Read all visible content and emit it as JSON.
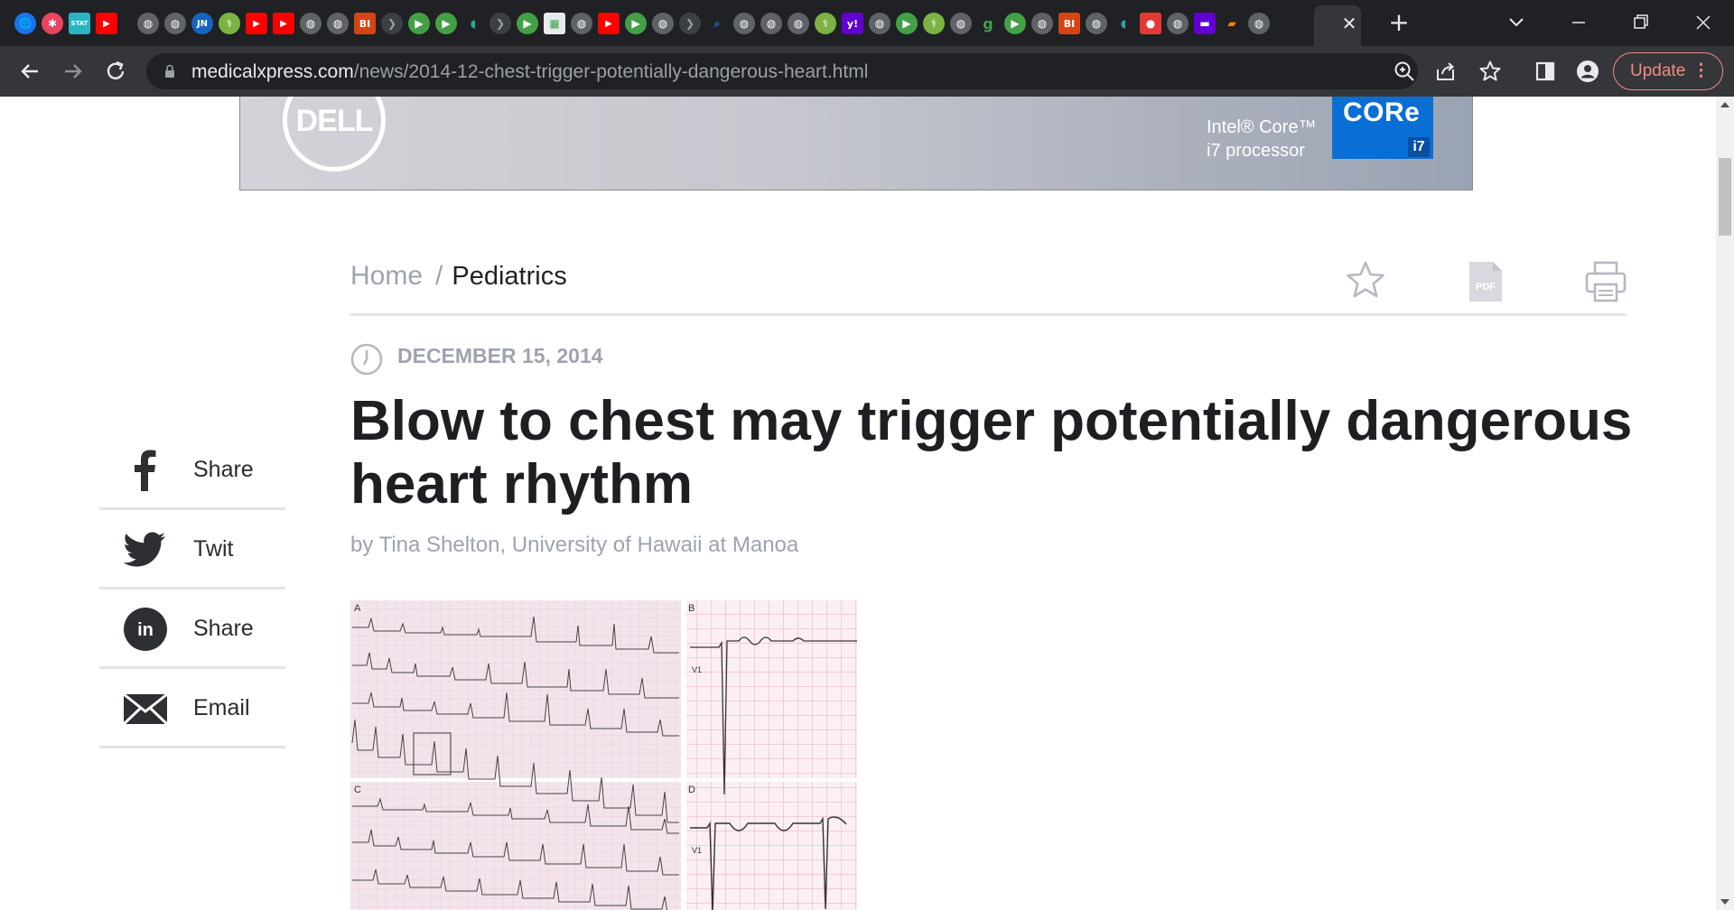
{
  "browser": {
    "tab_strip": {
      "favicons": [
        "globe-icon",
        "pinwheel-icon",
        "stat-icon",
        "youtube-icon",
        "globe-icon",
        "globe-icon",
        "jn-icon",
        "medical-icon",
        "youtube-icon",
        "youtube-icon",
        "globe-icon",
        "globe-icon",
        "bi-icon",
        "forward-icon",
        "play-icon",
        "play-icon",
        "shield-icon",
        "forward-icon",
        "play-icon",
        "puzzle-icon",
        "globe-icon",
        "youtube-icon",
        "play-icon",
        "globe-icon",
        "forward-icon",
        "search-icon",
        "globe-icon",
        "globe-icon",
        "globe-icon",
        "medical-icon",
        "yahoo-icon",
        "globe-icon",
        "play-icon",
        "medical-icon",
        "globe-icon",
        "g-icon",
        "play-icon",
        "globe-icon",
        "bi-icon",
        "globe-icon",
        "shield-icon",
        "mic-icon",
        "globe-icon",
        "flag-icon",
        "bookmark-icon",
        "globe-icon"
      ],
      "close_tab_glyph": "✕",
      "new_tab_glyph": "+"
    },
    "toolbar": {
      "url_host": "medicalxpress.com",
      "url_path": "/news/2014-12-chest-trigger-potentially-dangerous-heart.html",
      "update_label": "Update",
      "menu_glyph": "⋮"
    }
  },
  "ad": {
    "brand": "DELL",
    "intel_line1": "Intel® Core™",
    "intel_line2": "i7 processor",
    "core_label": "CORe",
    "core_tier": "i7"
  },
  "article": {
    "breadcrumb": {
      "home": "Home",
      "separator": "/",
      "current": "Pediatrics"
    },
    "date": "DECEMBER 15, 2014",
    "title": "Blow to chest may trigger potentially dangerous heart rhythm",
    "byline": "by Tina Shelton, University of Hawaii at Manoa",
    "figure_panel_labels": [
      "A",
      "B",
      "C",
      "D"
    ],
    "figure_lead_label": "V1"
  },
  "share": [
    {
      "label": "Share",
      "icon": "facebook-icon"
    },
    {
      "label": "Twit",
      "icon": "twitter-icon"
    },
    {
      "label": "Share",
      "icon": "linkedin-icon"
    },
    {
      "label": "Email",
      "icon": "email-icon"
    }
  ],
  "colors": {
    "chrome_dark": "#202124",
    "toolbar": "#35363a",
    "update_accent": "#f28b82",
    "muted_text": "#9ea3ad",
    "headline": "#1f1f23"
  }
}
